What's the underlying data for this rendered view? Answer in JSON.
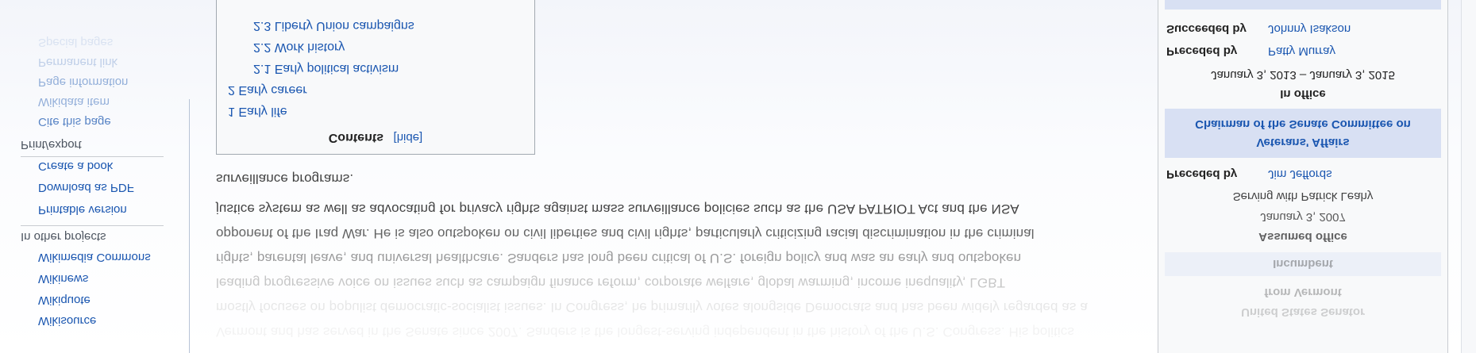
{
  "sidebar": {
    "wiki_links": [
      "Wikisource",
      "Wikiquote",
      "Wikinews",
      "Wikimedia Commons"
    ],
    "other_projects_heading": "In other projects",
    "print_heading": "Print/export",
    "print_links": [
      "Printable version",
      "Download as PDF",
      "Create a book"
    ],
    "tool_links": [
      "Cite this page",
      "Wikidata item",
      "Page information",
      "Permanent link",
      "Special pages"
    ]
  },
  "toc": {
    "title": "Contents",
    "hide_label": "[hide]",
    "items": [
      "2.3 Liberty Union campaigns",
      "2.2 Work history",
      "2.1 Early political activism",
      "2 Early career",
      "1 Early life"
    ]
  },
  "article": {
    "lines": [
      "surveillance programs.",
      "justice system as well as advocating for privacy rights against mass surveillance policies such as the USA PATRIOT Act and the NSA",
      "opponent of the Iraq War. He is also outspoken on civil liberties and civil rights, particularly criticizing racial discrimination in the criminal",
      "rights, parental leave, and universal healthcare. Sanders has long been critical of U.S. foreign policy and was an early and outspoken",
      "leading progressive voice on issues such as campaign finance reform, corporate welfare, global warming, income inequality, LGBT",
      "mostly focuses on populist democratic-socialist issues. In Congress, he primarily votes alongside Democrats and has been widely regarded as a",
      "Vermont and has served in the Senate since 2007. Sanders is the longest-serving independent in the history of the U.S. Congress. His politics"
    ]
  },
  "infobox": {
    "top_row": {
      "label": "Succeeded by",
      "value": "Johnny Isakson"
    },
    "preceded_1": {
      "label": "Preceded by",
      "value": "Patty Murray"
    },
    "term_2": "January 3, 2013 – January 3, 2015",
    "in_office": "In office",
    "chair_title_line1": "Chairman of the Senate Committee on",
    "chair_title_line2": "Veterans' Affairs",
    "preceded_2": {
      "label": "Preceded by",
      "value": "Jim Jeffords"
    },
    "serving_with": "Serving with Patrick Leahy",
    "assumed_date": "January 3, 2007",
    "assumed_office": "Assumed office",
    "incumbent": "Incumbent",
    "from_state": "from Vermont",
    "senator_title": "United States Senator"
  },
  "colors": {
    "link": "#1a56b0",
    "infobox_band": "#d8e0f3",
    "background": "#ffffff"
  }
}
